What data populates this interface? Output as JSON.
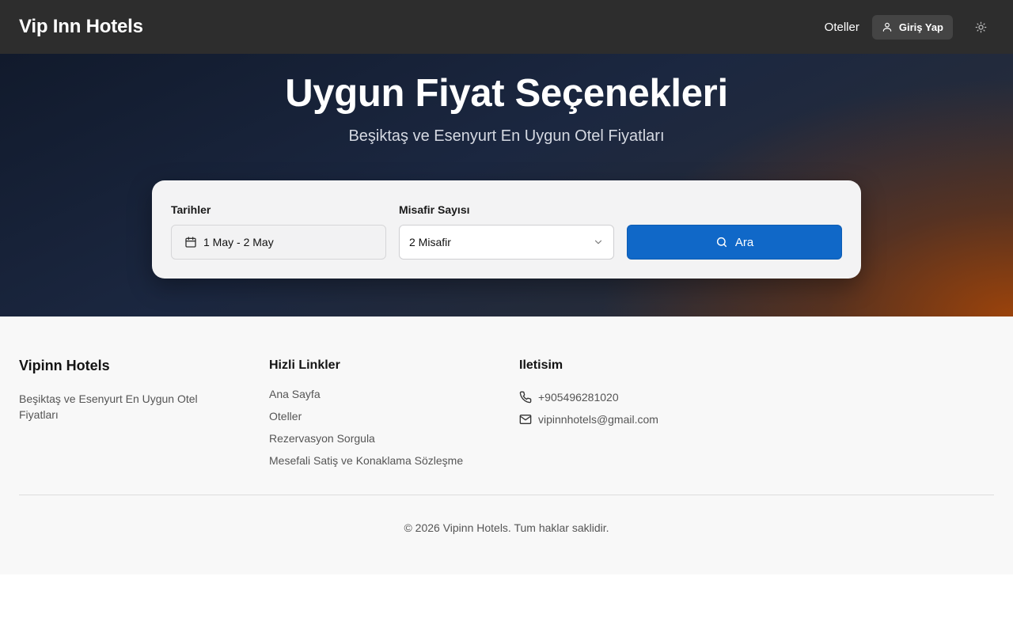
{
  "header": {
    "brand": "Vip Inn Hotels",
    "nav_hotels": "Oteller",
    "login_label": "Giriş Yap",
    "icons": {
      "user": "user-icon",
      "theme": "sun-icon"
    }
  },
  "hero": {
    "title": "Uygun Fiyat Seçenekleri",
    "subtitle": "Beşiktaş ve Esenyurt En Uygun Otel Fiyatları"
  },
  "search": {
    "dates_label": "Tarihler",
    "dates_value": "1 May - 2 May",
    "guests_label": "Misafir Sayısı",
    "guests_value": "2 Misafir",
    "search_label": "Ara",
    "colors": {
      "button": "#1068c8"
    },
    "icons": {
      "calendar": "calendar-icon",
      "chevron": "chevron-down-icon",
      "search": "search-icon"
    }
  },
  "footer": {
    "brand": "Vipinn Hotels",
    "description": "Beşiktaş ve Esenyurt En Uygun Otel Fiyatları",
    "links_heading": "Hizli Linkler",
    "links": [
      "Ana Sayfa",
      "Oteller",
      "Rezervasyon Sorgula",
      "Mesefali Satiş ve Konaklama Sözleşme"
    ],
    "contact_heading": "Iletisim",
    "phone": "+905496281020",
    "email": "vipinnhotels@gmail.com",
    "copyright": "© 2026 Vipinn Hotels. Tum haklar saklidir.",
    "icons": {
      "phone": "phone-icon",
      "email": "mail-icon"
    }
  }
}
